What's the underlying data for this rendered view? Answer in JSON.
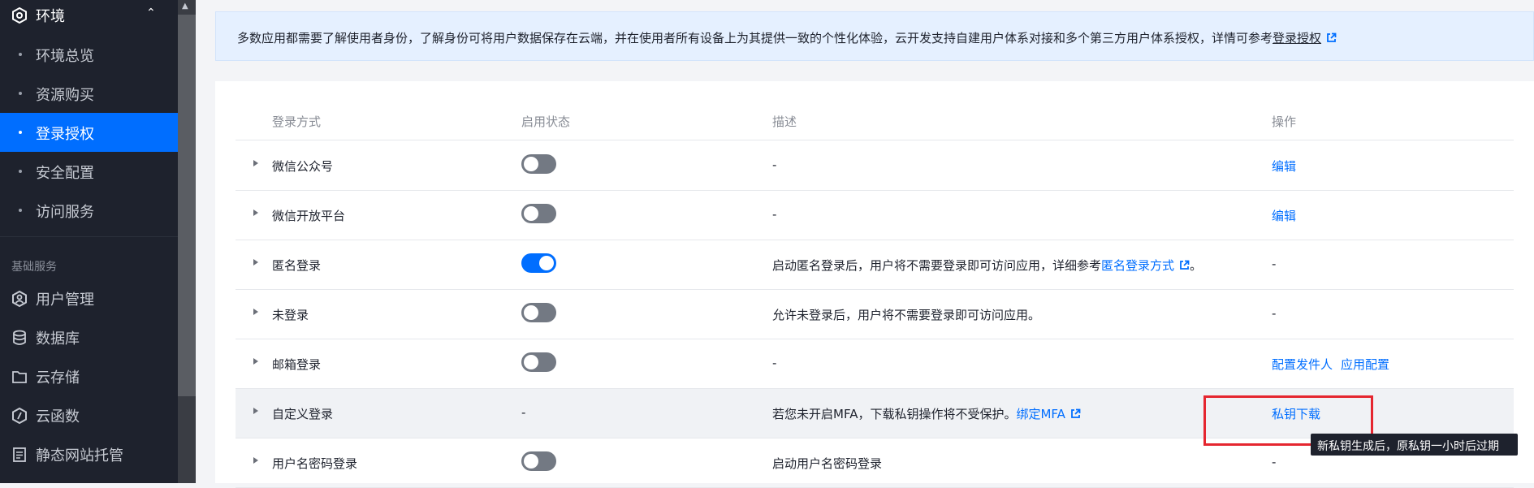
{
  "sidebar": {
    "env": {
      "label": "环境",
      "icon": "hexagon-icon",
      "chevron": "chevron-up-icon"
    },
    "sub_items": [
      {
        "label": "环境总览",
        "active": false
      },
      {
        "label": "资源购买",
        "active": false
      },
      {
        "label": "登录授权",
        "active": true
      },
      {
        "label": "安全配置",
        "active": false
      },
      {
        "label": "访问服务",
        "active": false
      }
    ],
    "section_title": "基础服务",
    "main_items": [
      {
        "label": "用户管理",
        "icon": "user-hex-icon"
      },
      {
        "label": "数据库",
        "icon": "database-icon"
      },
      {
        "label": "云存储",
        "icon": "folder-icon"
      },
      {
        "label": "云函数",
        "icon": "function-icon"
      },
      {
        "label": "静态网站托管",
        "icon": "document-icon"
      }
    ]
  },
  "notice": {
    "text": "多数应用都需要了解使用者身份，了解身份可将用户数据保存在云端，并在使用者所有设备上为其提供一致的个性化体验，云开发支持自建用户体系对接和多个第三方用户体系授权，详情可参考",
    "link_label": "登录授权"
  },
  "table": {
    "headers": {
      "method": "登录方式",
      "status": "启用状态",
      "desc": "描述",
      "ops": "操作"
    },
    "rows": [
      {
        "name": "微信公众号",
        "enabled": false,
        "desc": "-",
        "ops": [
          "编辑"
        ]
      },
      {
        "name": "微信开放平台",
        "enabled": false,
        "desc": "-",
        "ops": [
          "编辑"
        ]
      },
      {
        "name": "匿名登录",
        "enabled": true,
        "desc": "启动匿名登录后，用户将不需要登录即可访问应用，详细参考",
        "desc_link": "匿名登录方式",
        "desc_suffix": "。",
        "ops_text": "-"
      },
      {
        "name": "未登录",
        "enabled": false,
        "desc": "允许未登录后，用户将不需要登录即可访问应用。",
        "ops_text": "-"
      },
      {
        "name": "邮箱登录",
        "enabled": false,
        "desc": "-",
        "ops": [
          "配置发件人",
          "应用配置"
        ]
      },
      {
        "name": "自定义登录",
        "status_text": "-",
        "desc": "若您未开启MFA，下载私钥操作将不受保护。",
        "desc_link": "绑定MFA",
        "ops": [
          "私钥下载"
        ]
      },
      {
        "name": "用户名密码登录",
        "enabled": false,
        "desc": "启动用户名密码登录",
        "ops_text": "-"
      }
    ]
  },
  "tooltip": {
    "text": "新私钥生成后，原私钥一小时后过期"
  },
  "colors": {
    "accent": "#006eff",
    "sidebar_bg": "#1e222d",
    "highlight": "#e5262f"
  }
}
